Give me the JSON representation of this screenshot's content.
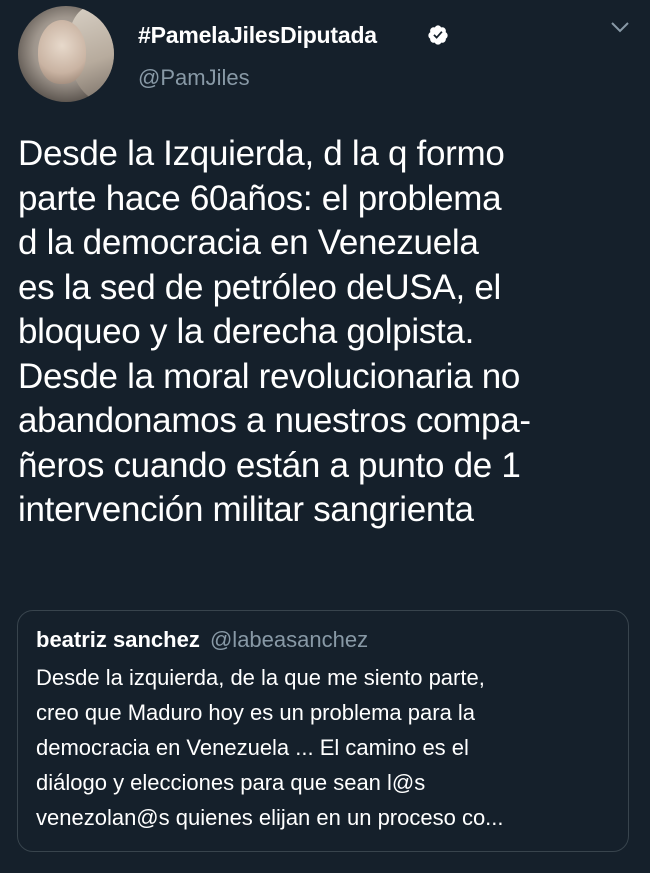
{
  "tweet": {
    "display_name": "#PamelaJilesDiputada",
    "handle": "@PamJiles",
    "verified": true,
    "text": "Desde la Izquierda, d la q formo\nparte hace 60años: el problema\nd la democracia en Venezuela\nes la sed de petróleo deUSA, el\nbloqueo y la derecha golpista.\nDesde la moral revolucionaria no\nabandonamos a nuestros compa-\nñeros cuando están a punto de 1\nintervención militar sangrienta"
  },
  "quoted_tweet": {
    "display_name": "beatriz sanchez",
    "handle": "@labeasanchez",
    "text": "Desde la izquierda, de la que me siento parte,\ncreo que Maduro hoy es un problema para la\ndemocracia en Venezuela ... El camino es el\ndiálogo y elecciones para que sean l@s\nvenezolan@s quienes elijan en un proceso co..."
  },
  "icons": {
    "verified": "verified-badge-icon",
    "menu": "chevron-down-icon"
  },
  "colors": {
    "background": "#15202b",
    "secondary_text": "#8899a6",
    "border": "#38444d"
  }
}
